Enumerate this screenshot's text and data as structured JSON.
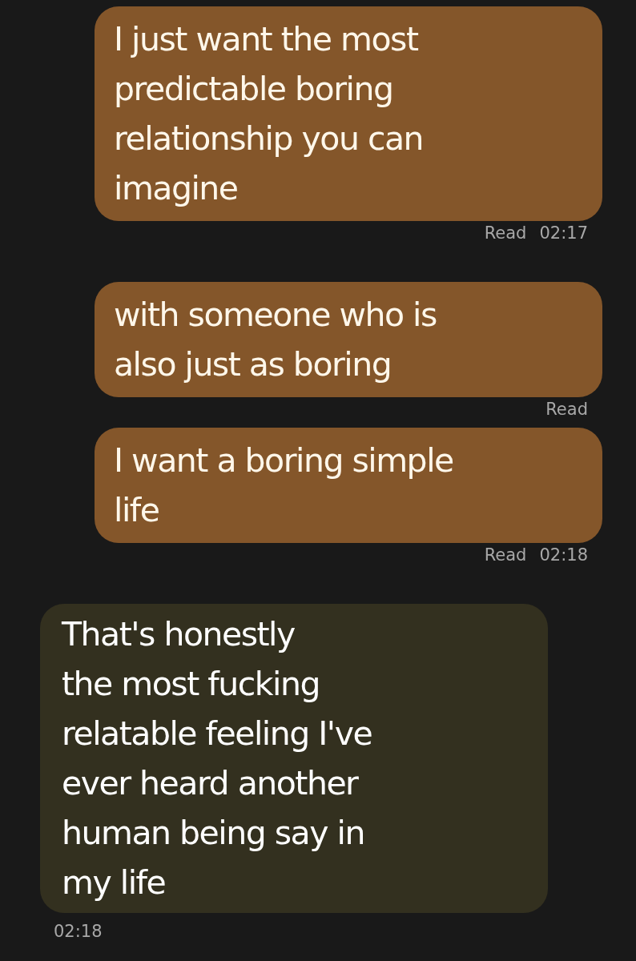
{
  "messages": [
    {
      "kind": "outgoing",
      "lines": [
        "I just want the most",
        "predictable boring",
        "relationship you can",
        "imagine"
      ],
      "status": "Read",
      "time": "02:17"
    },
    {
      "kind": "outgoing",
      "lines": [
        "with someone who is",
        "also just as boring"
      ],
      "status": "Read"
    },
    {
      "kind": "outgoing",
      "lines": [
        "I want a boring simple",
        "life"
      ],
      "status": "Read",
      "time": "02:18"
    },
    {
      "kind": "incoming",
      "lines": [
        "That's honestly",
        "the most fucking",
        "relatable feeling I've",
        "ever heard another",
        "human being say in",
        "my life"
      ],
      "time": "02:18"
    }
  ]
}
